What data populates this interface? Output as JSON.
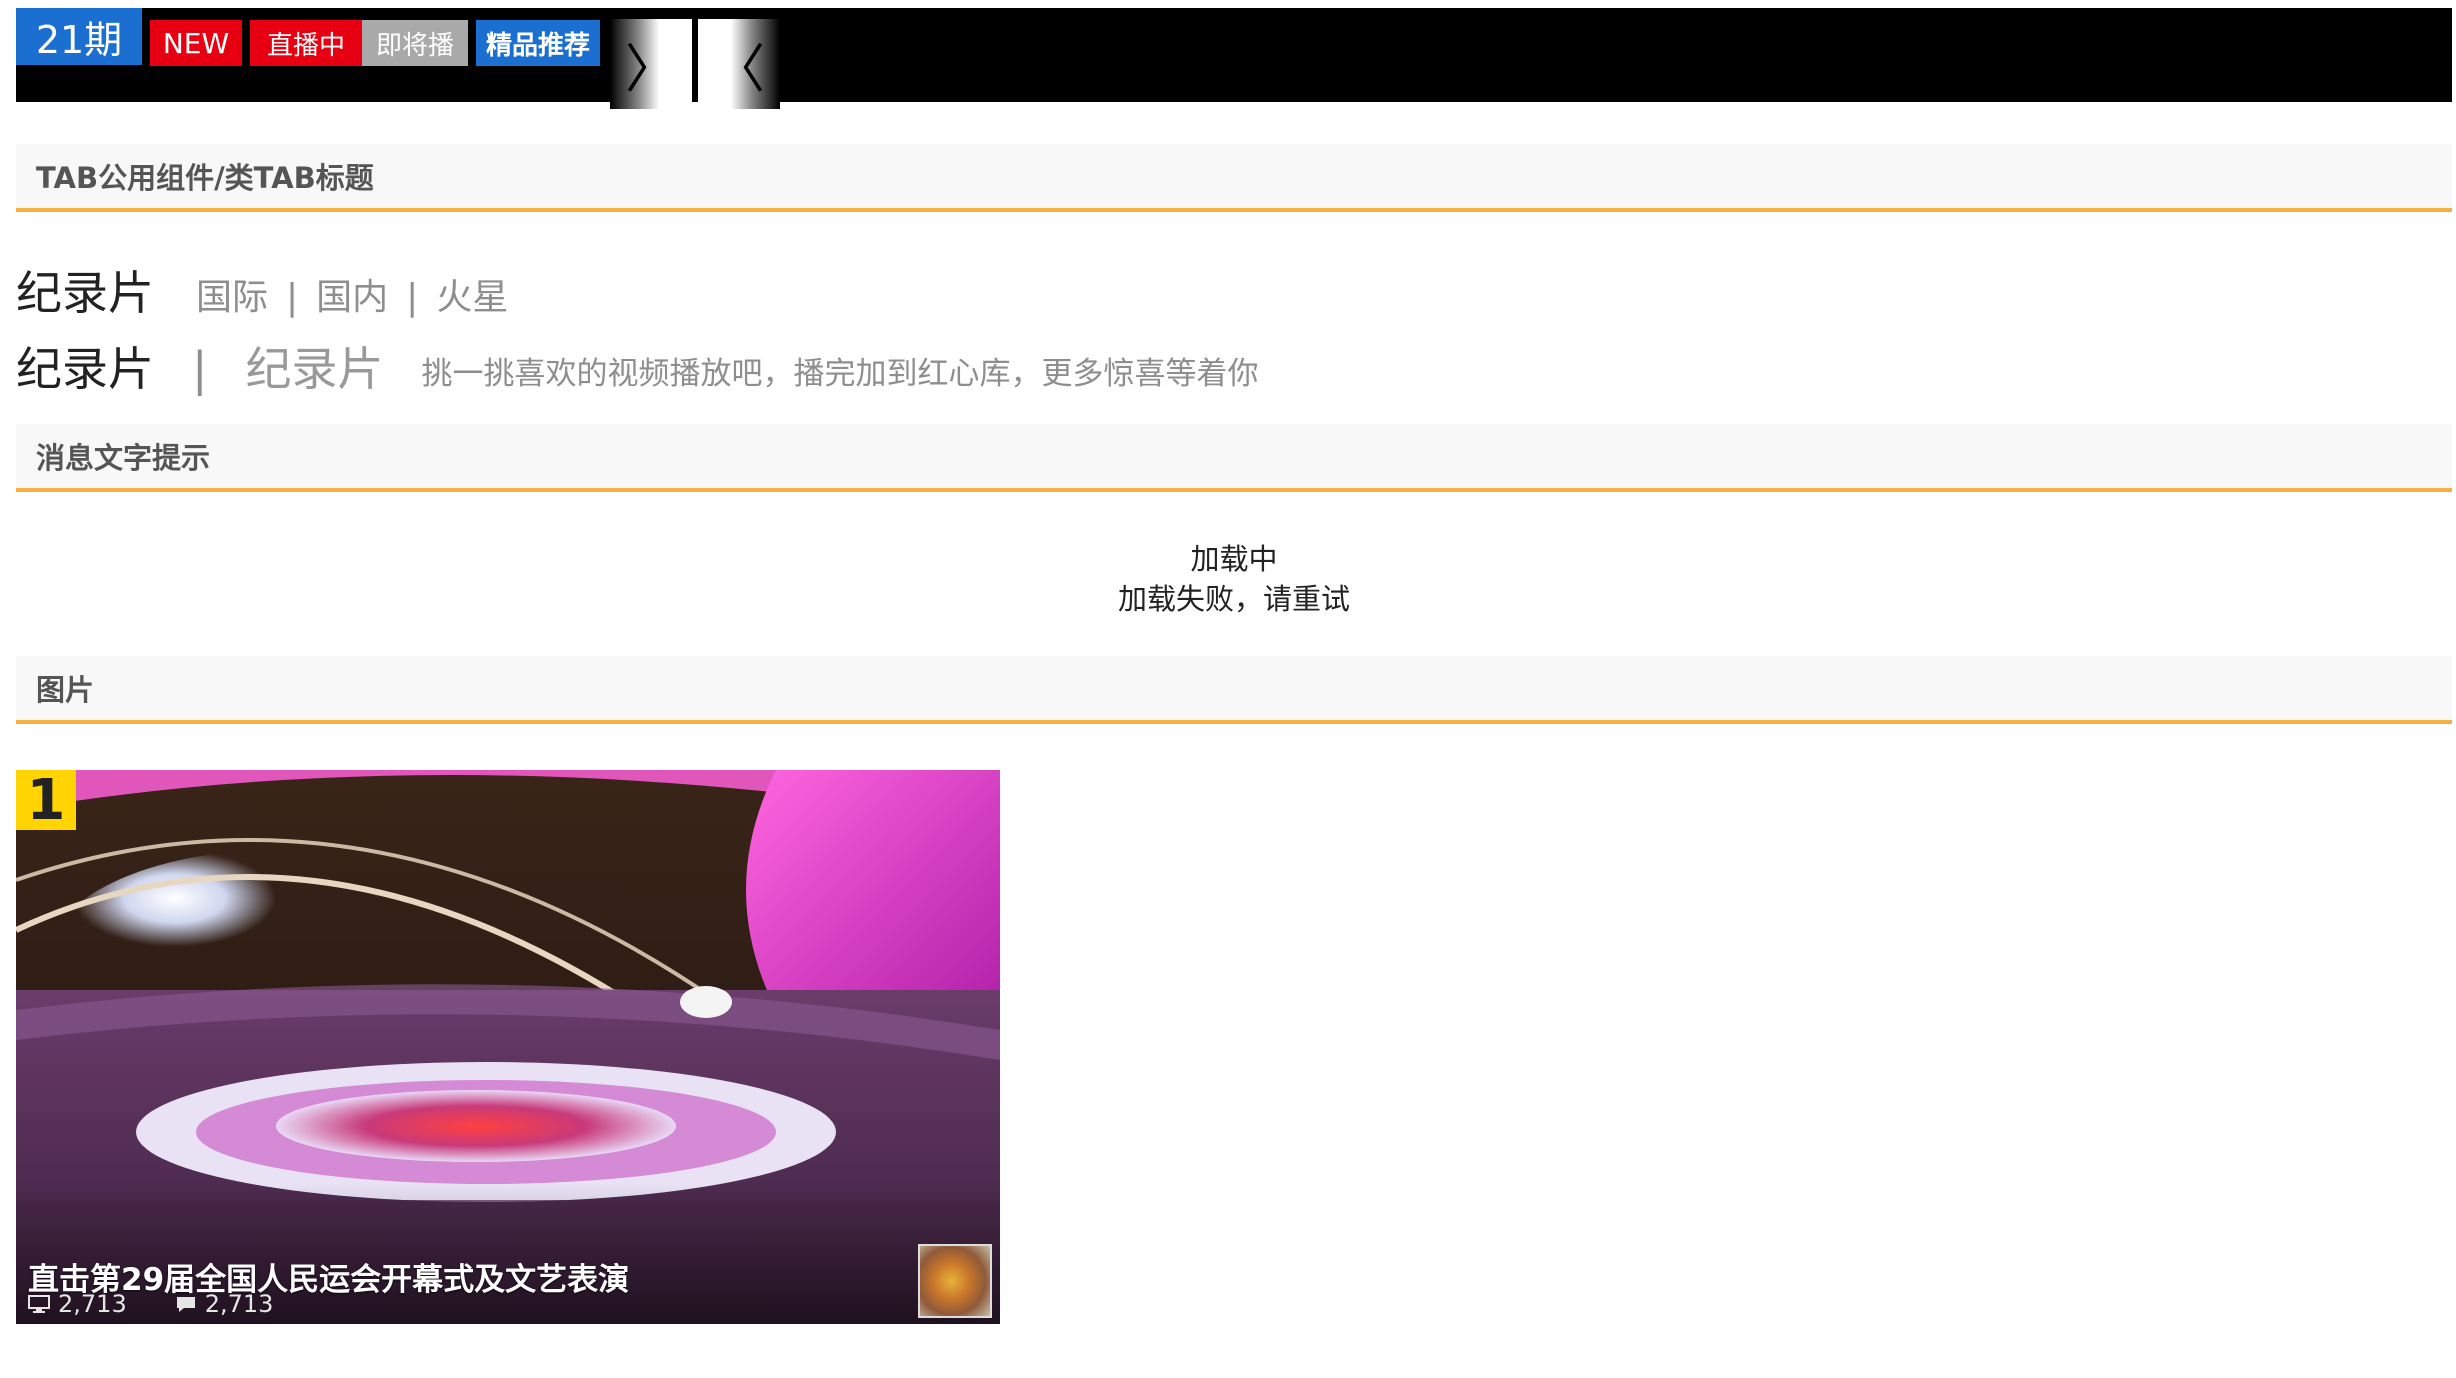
{
  "topbar": {
    "issue": "21期",
    "badges": {
      "new": "NEW",
      "live": "直播中",
      "upcoming": "即将播",
      "featured": "精品推荐"
    },
    "next_arrow": "〉",
    "prev_arrow": "〈",
    "colors": {
      "bar": "#000000",
      "blue": "#1a6fd1",
      "red": "#e60012",
      "gray": "#a9a9a9"
    }
  },
  "sections": {
    "tab": "TAB公用组件/类TAB标题",
    "message": "消息文字提示",
    "image": "图片",
    "accent_color": "#f5b041"
  },
  "tab_titles": {
    "row1": {
      "main": "纪录片",
      "items": [
        "国际",
        "国内",
        "火星"
      ],
      "separator": "|"
    },
    "row2": {
      "main": "纪录片",
      "separator": "|",
      "secondary": "纪录片",
      "description": "挑一挑喜欢的视频播放吧，播完加到红心库，更多惊喜等着你"
    }
  },
  "messages": {
    "loading": "加载中",
    "failed": "加载失败，请重试"
  },
  "card": {
    "rank": "1",
    "title": "直击第29届全国人民运会开幕式及文艺表演",
    "views": "2,713",
    "comments": "2,713",
    "view_icon": "monitor-icon",
    "comment_icon": "comment-icon",
    "rank_color": "#ffd400"
  }
}
